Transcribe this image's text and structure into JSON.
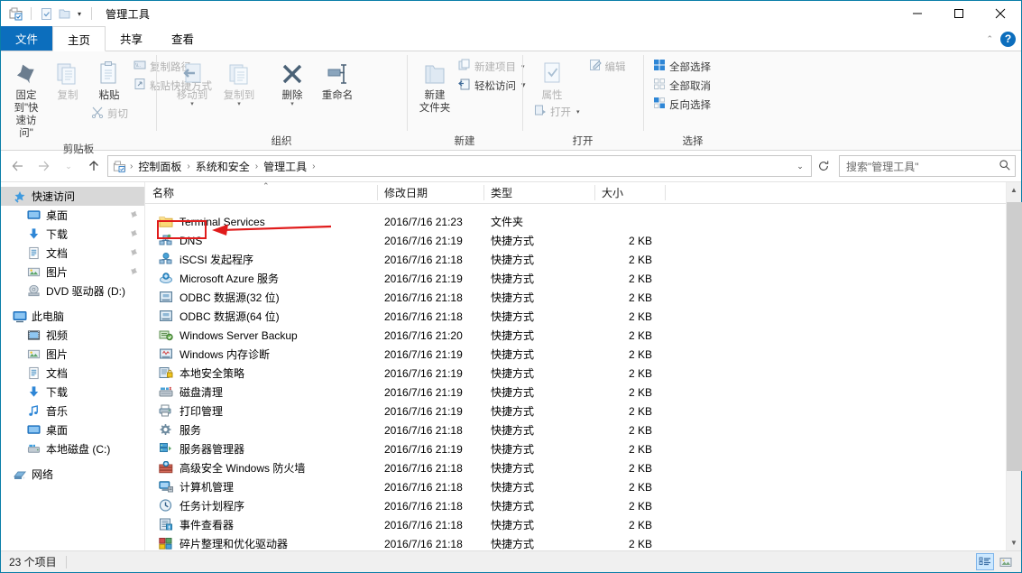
{
  "window": {
    "title": "管理工具",
    "minimize_label": "最小化",
    "maximize_label": "最大化",
    "close_label": "关闭",
    "help_label": "?",
    "ribbon_collapse_label": "^"
  },
  "quick_access": {
    "folder_icon": "folder-properties-icon",
    "properties_icon": "properties-icon",
    "new_folder_icon": "new-folder-icon",
    "dropdown_caret": "▾"
  },
  "tabs": [
    {
      "label": "文件",
      "kind": "file",
      "active": false
    },
    {
      "label": "主页",
      "kind": "normal",
      "active": true
    },
    {
      "label": "共享",
      "kind": "normal",
      "active": false
    },
    {
      "label": "查看",
      "kind": "normal",
      "active": false
    }
  ],
  "ribbon": {
    "groups": [
      {
        "label": "剪贴板",
        "big": [
          {
            "label": "固定到\"快\n速访问\"",
            "icon": "pin-icon",
            "dim": false
          },
          {
            "label": "复制",
            "icon": "copy-icon",
            "dim": true
          },
          {
            "label": "粘贴",
            "icon": "paste-icon",
            "dim": false
          }
        ],
        "small_under_paste": [
          {
            "label": "剪切",
            "icon": "scissors-icon",
            "dim": true
          }
        ],
        "small": [
          {
            "label": "复制路径",
            "icon": "copy-path-icon",
            "dim": true
          },
          {
            "label": "粘贴快捷方式",
            "icon": "paste-shortcut-icon",
            "dim": true
          }
        ]
      },
      {
        "label": "组织",
        "big": [
          {
            "label": "移动到",
            "icon": "move-to-icon",
            "dim": true,
            "caret": true
          },
          {
            "label": "复制到",
            "icon": "copy-to-icon",
            "dim": true,
            "caret": true
          },
          {
            "label": "删除",
            "icon": "delete-x-icon",
            "dim": false,
            "caret": true
          },
          {
            "label": "重命名",
            "icon": "rename-icon",
            "dim": false
          }
        ]
      },
      {
        "label": "新建",
        "big": [
          {
            "label": "新建\n文件夹",
            "icon": "new-folder-icon",
            "dim": false
          }
        ],
        "small": [
          {
            "label": "新建项目",
            "icon": "new-item-icon",
            "dim": true,
            "caret": true
          },
          {
            "label": "轻松访问",
            "icon": "easy-access-icon",
            "dim": false,
            "caret": true
          }
        ]
      },
      {
        "label": "打开",
        "big": [
          {
            "label": "属性",
            "icon": "properties-check-icon",
            "dim": true
          }
        ],
        "small": [
          {
            "label": "编辑",
            "icon": "edit-icon",
            "dim": true
          },
          {
            "label": "打开",
            "icon": "open-icon",
            "dim": true,
            "caret": true
          }
        ]
      },
      {
        "label": "选择",
        "small": [
          {
            "label": "全部选择",
            "icon": "select-all-icon",
            "dim": false
          },
          {
            "label": "全部取消",
            "icon": "select-none-icon",
            "dim": false
          },
          {
            "label": "反向选择",
            "icon": "invert-selection-icon",
            "dim": false
          }
        ]
      }
    ]
  },
  "address": {
    "back_icon": "back-arrow-icon",
    "forward_icon": "forward-arrow-icon",
    "recent_icon": "chevron-down-icon",
    "up_icon": "up-arrow-icon",
    "breadcrumb_icon": "control-panel-icon",
    "crumbs": [
      "控制面板",
      "系统和安全",
      "管理工具"
    ],
    "separator": "›",
    "dropdown_caret": "⌄",
    "refresh_icon": "refresh-icon"
  },
  "search": {
    "placeholder": "搜索\"管理工具\"",
    "icon": "search-icon"
  },
  "sidebar": {
    "items": [
      {
        "label": "快速访问",
        "icon": "quick-access-star-icon",
        "level": 0,
        "pin": false,
        "highlight": true
      },
      {
        "label": "桌面",
        "icon": "desktop-icon",
        "level": 1,
        "pin": true
      },
      {
        "label": "下载",
        "icon": "downloads-icon",
        "level": 1,
        "pin": true
      },
      {
        "label": "文档",
        "icon": "documents-icon",
        "level": 1,
        "pin": true
      },
      {
        "label": "图片",
        "icon": "pictures-icon",
        "level": 1,
        "pin": true
      },
      {
        "label": "DVD 驱动器 (D:)",
        "icon": "dvd-drive-icon",
        "level": 1,
        "pin": false
      },
      {
        "label": "此电脑",
        "icon": "this-pc-icon",
        "level": 0,
        "pin": false,
        "gap_before": true
      },
      {
        "label": "视频",
        "icon": "videos-icon",
        "level": 1,
        "pin": false
      },
      {
        "label": "图片",
        "icon": "pictures-icon",
        "level": 1,
        "pin": false
      },
      {
        "label": "文档",
        "icon": "documents-icon",
        "level": 1,
        "pin": false
      },
      {
        "label": "下载",
        "icon": "downloads-icon",
        "level": 1,
        "pin": false
      },
      {
        "label": "音乐",
        "icon": "music-icon",
        "level": 1,
        "pin": false
      },
      {
        "label": "桌面",
        "icon": "desktop-icon",
        "level": 1,
        "pin": false
      },
      {
        "label": "本地磁盘 (C:)",
        "icon": "local-disk-icon",
        "level": 1,
        "pin": false
      },
      {
        "label": "网络",
        "icon": "network-icon",
        "level": 0,
        "pin": false,
        "gap_before": true
      }
    ]
  },
  "filelist": {
    "columns": [
      {
        "label": "名称",
        "key": "name",
        "sorted": "asc"
      },
      {
        "label": "修改日期",
        "key": "date"
      },
      {
        "label": "类型",
        "key": "type"
      },
      {
        "label": "大小",
        "key": "size"
      }
    ],
    "rows": [
      {
        "name": "Terminal Services",
        "date": "2016/7/16 21:23",
        "type": "文件夹",
        "size": "",
        "icon": "folder-icon"
      },
      {
        "name": "DNS",
        "date": "2016/7/16 21:19",
        "type": "快捷方式",
        "size": "2 KB",
        "icon": "dns-icon",
        "annotated": true
      },
      {
        "name": "iSCSI 发起程序",
        "date": "2016/7/16 21:18",
        "type": "快捷方式",
        "size": "2 KB",
        "icon": "iscsi-icon"
      },
      {
        "name": "Microsoft Azure 服务",
        "date": "2016/7/16 21:19",
        "type": "快捷方式",
        "size": "2 KB",
        "icon": "azure-icon"
      },
      {
        "name": "ODBC 数据源(32 位)",
        "date": "2016/7/16 21:18",
        "type": "快捷方式",
        "size": "2 KB",
        "icon": "odbc-icon"
      },
      {
        "name": "ODBC 数据源(64 位)",
        "date": "2016/7/16 21:18",
        "type": "快捷方式",
        "size": "2 KB",
        "icon": "odbc-icon"
      },
      {
        "name": "Windows Server Backup",
        "date": "2016/7/16 21:20",
        "type": "快捷方式",
        "size": "2 KB",
        "icon": "backup-icon"
      },
      {
        "name": "Windows 内存诊断",
        "date": "2016/7/16 21:19",
        "type": "快捷方式",
        "size": "2 KB",
        "icon": "memory-icon"
      },
      {
        "name": "本地安全策略",
        "date": "2016/7/16 21:19",
        "type": "快捷方式",
        "size": "2 KB",
        "icon": "security-policy-icon"
      },
      {
        "name": "磁盘清理",
        "date": "2016/7/16 21:19",
        "type": "快捷方式",
        "size": "2 KB",
        "icon": "disk-cleanup-icon"
      },
      {
        "name": "打印管理",
        "date": "2016/7/16 21:19",
        "type": "快捷方式",
        "size": "2 KB",
        "icon": "print-management-icon"
      },
      {
        "name": "服务",
        "date": "2016/7/16 21:18",
        "type": "快捷方式",
        "size": "2 KB",
        "icon": "services-icon"
      },
      {
        "name": "服务器管理器",
        "date": "2016/7/16 21:19",
        "type": "快捷方式",
        "size": "2 KB",
        "icon": "server-manager-icon"
      },
      {
        "name": "高级安全 Windows 防火墙",
        "date": "2016/7/16 21:18",
        "type": "快捷方式",
        "size": "2 KB",
        "icon": "firewall-icon"
      },
      {
        "name": "计算机管理",
        "date": "2016/7/16 21:18",
        "type": "快捷方式",
        "size": "2 KB",
        "icon": "computer-management-icon"
      },
      {
        "name": "任务计划程序",
        "date": "2016/7/16 21:18",
        "type": "快捷方式",
        "size": "2 KB",
        "icon": "task-scheduler-icon"
      },
      {
        "name": "事件查看器",
        "date": "2016/7/16 21:18",
        "type": "快捷方式",
        "size": "2 KB",
        "icon": "event-viewer-icon"
      },
      {
        "name": "碎片整理和优化驱动器",
        "date": "2016/7/16 21:18",
        "type": "快捷方式",
        "size": "2 KB",
        "icon": "defrag-icon"
      }
    ]
  },
  "status": {
    "item_count": "23 个项目",
    "details_view_icon": "details-view-icon",
    "large_icons_view_icon": "large-icons-view-icon"
  },
  "annotation": {
    "color": "#e01b1b",
    "target": "DNS"
  },
  "colors": {
    "accent": "#0c6ebd",
    "window_border": "#0a7ea8",
    "ribbon_bg": "#fafafa",
    "status_bg": "#f0f0f0",
    "annotation_red": "#e01b1b"
  }
}
